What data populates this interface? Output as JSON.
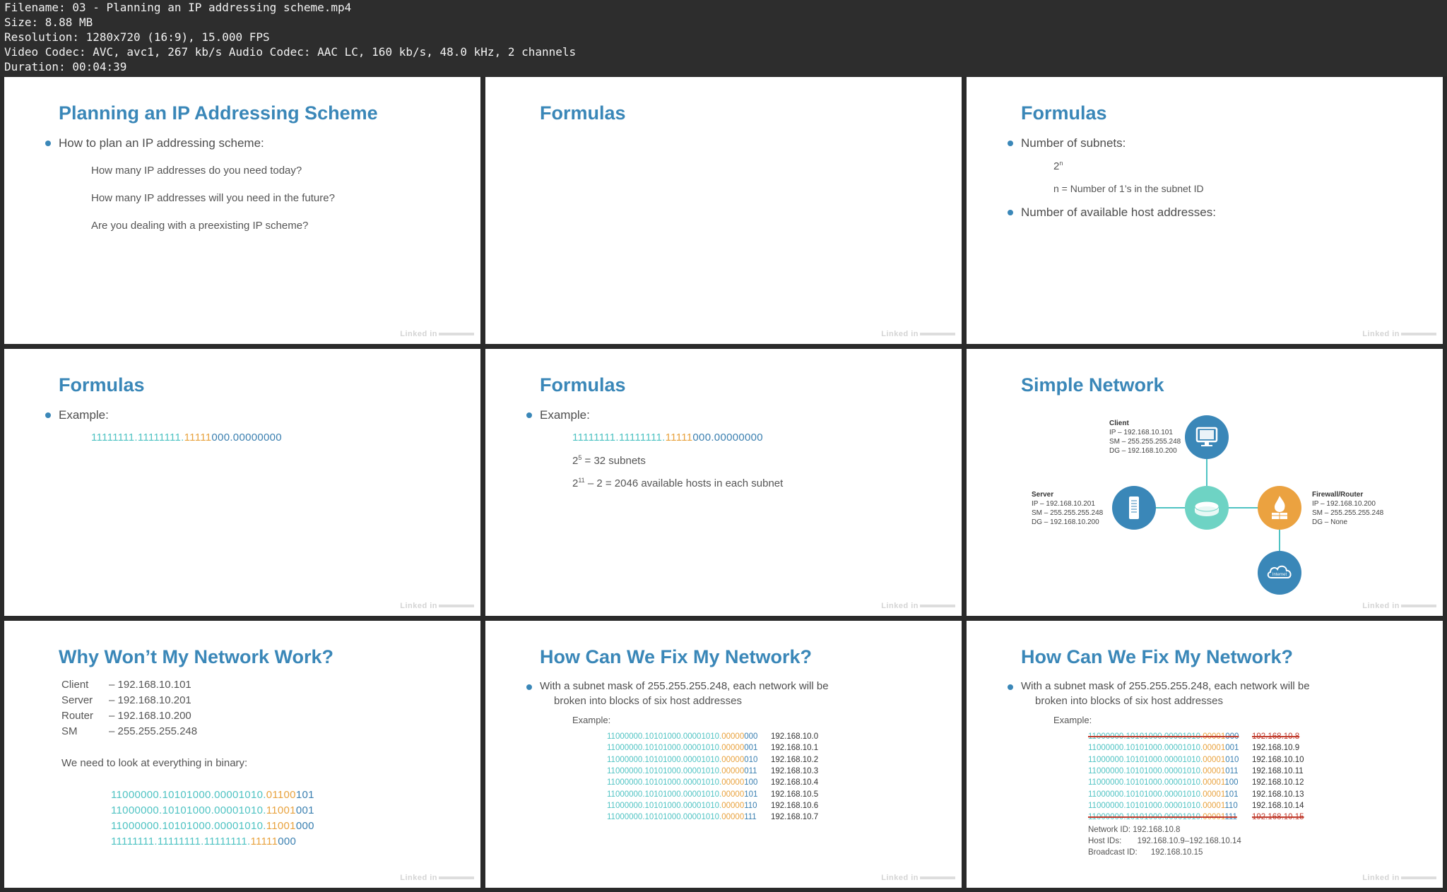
{
  "header": {
    "filename": "Filename: 03 - Planning an IP addressing scheme.mp4",
    "size": "Size: 8.88 MB",
    "resolution": "Resolution: 1280x720 (16:9), 15.000 FPS",
    "codec": "Video Codec: AVC, avc1, 267 kb/s Audio Codec: AAC LC, 160 kb/s, 48.0 kHz, 2 channels",
    "duration": "Duration: 00:04:39"
  },
  "watermark": "Linked in",
  "slide1": {
    "title": "Planning an IP Addressing Scheme",
    "bullet": "How to plan an IP addressing scheme:",
    "items": [
      "How many IP addresses do you need today?",
      "How many IP addresses will you need in the future?",
      "Are you dealing with a preexisting IP scheme?"
    ]
  },
  "slide2": {
    "title": "Formulas"
  },
  "slide3": {
    "title": "Formulas",
    "bullet1": "Number of subnets:",
    "formula_base": "2",
    "formula_exp": "n",
    "formula_def": "n = Number of 1’s in the subnet ID",
    "bullet2": "Number of available host addresses:"
  },
  "slide4": {
    "title": "Formulas",
    "bullet": "Example:",
    "mask_teal": "11111111.11111111.",
    "mask_orange": "11111",
    "mask_blue": "000.00000000"
  },
  "slide5": {
    "title": "Formulas",
    "bullet": "Example:",
    "mask_teal": "11111111.11111111.",
    "mask_orange": "11111",
    "mask_blue": "000.00000000",
    "eq1_base": "2",
    "eq1_exp": "5",
    "eq1_rest": " = 32 subnets",
    "eq2_base": "2",
    "eq2_exp": "11",
    "eq2_rest": " – 2 = 2046 available hosts in each subnet"
  },
  "slide6": {
    "title": "Simple Network",
    "client": {
      "name": "Client",
      "ip": "IP – 192.168.10.101",
      "sm": "SM – 255.255.255.248",
      "dg": "DG – 192.168.10.200"
    },
    "server": {
      "name": "Server",
      "ip": "IP – 192.168.10.201",
      "sm": "SM – 255.255.255.248",
      "dg": "DG – 192.168.10.200"
    },
    "firewall": {
      "name": "Firewall/Router",
      "ip": "IP – 192.168.10.200",
      "sm": "SM – 255.255.255.248",
      "dg": "DG – None"
    },
    "internet": "Internet"
  },
  "slide7": {
    "title": "Why Won’t My Network Work?",
    "rows": [
      {
        "label": "Client",
        "value": "– 192.168.10.101"
      },
      {
        "label": "Server",
        "value": "– 192.168.10.201"
      },
      {
        "label": "Router",
        "value": "– 192.168.10.200"
      },
      {
        "label": "SM",
        "value": "– 255.255.255.248"
      }
    ],
    "note": "We need to look at everything in binary:",
    "binary": [
      {
        "teal": "11000000.10101000.00001010.",
        "orange": "01100",
        "blue": "101"
      },
      {
        "teal": "11000000.10101000.00001010.",
        "orange": "11001",
        "blue": "001"
      },
      {
        "teal": "11000000.10101000.00001010.",
        "orange": "11001",
        "blue": "000"
      },
      {
        "teal": "11111111.11111111.11111111.",
        "orange": "11111",
        "blue": "000"
      }
    ]
  },
  "slide8": {
    "title": "How Can We Fix My Network?",
    "bullet_line1": "With a subnet mask of 255.255.255.248, each network will be",
    "bullet_line2": "broken into blocks of six host addresses",
    "example": "Example:",
    "rows": [
      {
        "teal": "11000000.10101000.00001010.",
        "orange": "00000",
        "blue": "000",
        "ip": "192.168.10.0"
      },
      {
        "teal": "11000000.10101000.00001010.",
        "orange": "00000",
        "blue": "001",
        "ip": "192.168.10.1"
      },
      {
        "teal": "11000000.10101000.00001010.",
        "orange": "00000",
        "blue": "010",
        "ip": "192.168.10.2"
      },
      {
        "teal": "11000000.10101000.00001010.",
        "orange": "00000",
        "blue": "011",
        "ip": "192.168.10.3"
      },
      {
        "teal": "11000000.10101000.00001010.",
        "orange": "00000",
        "blue": "100",
        "ip": "192.168.10.4"
      },
      {
        "teal": "11000000.10101000.00001010.",
        "orange": "00000",
        "blue": "101",
        "ip": "192.168.10.5"
      },
      {
        "teal": "11000000.10101000.00001010.",
        "orange": "00000",
        "blue": "110",
        "ip": "192.168.10.6"
      },
      {
        "teal": "11000000.10101000.00001010.",
        "orange": "00000",
        "blue": "111",
        "ip": "192.168.10.7"
      }
    ]
  },
  "slide9": {
    "title": "How Can We Fix My Network?",
    "bullet_line1": "With a subnet mask of 255.255.255.248, each network will be",
    "bullet_line2": "broken into blocks of six host addresses",
    "example": "Example:",
    "rows": [
      {
        "teal": "11000000.10101000.00001010.",
        "orange": "00001",
        "blue": "000",
        "ip": "192.168.10.8",
        "struck": true
      },
      {
        "teal": "11000000.10101000.00001010.",
        "orange": "00001",
        "blue": "001",
        "ip": "192.168.10.9",
        "struck": false
      },
      {
        "teal": "11000000.10101000.00001010.",
        "orange": "00001",
        "blue": "010",
        "ip": "192.168.10.10",
        "struck": false
      },
      {
        "teal": "11000000.10101000.00001010.",
        "orange": "00001",
        "blue": "011",
        "ip": "192.168.10.11",
        "struck": false
      },
      {
        "teal": "11000000.10101000.00001010.",
        "orange": "00001",
        "blue": "100",
        "ip": "192.168.10.12",
        "struck": false
      },
      {
        "teal": "11000000.10101000.00001010.",
        "orange": "00001",
        "blue": "101",
        "ip": "192.168.10.13",
        "struck": false
      },
      {
        "teal": "11000000.10101000.00001010.",
        "orange": "00001",
        "blue": "110",
        "ip": "192.168.10.14",
        "struck": false
      },
      {
        "teal": "11000000.10101000.00001010.",
        "orange": "00001",
        "blue": "111",
        "ip": "192.168.10.15",
        "struck": true
      }
    ],
    "network_id_label": "Network ID:",
    "network_id": "192.168.10.8",
    "host_ids_label": "Host IDs:",
    "host_ids": "192.168.10.9–192.168.10.14",
    "broadcast_label": "Broadcast ID:",
    "broadcast": "192.168.10.15"
  }
}
